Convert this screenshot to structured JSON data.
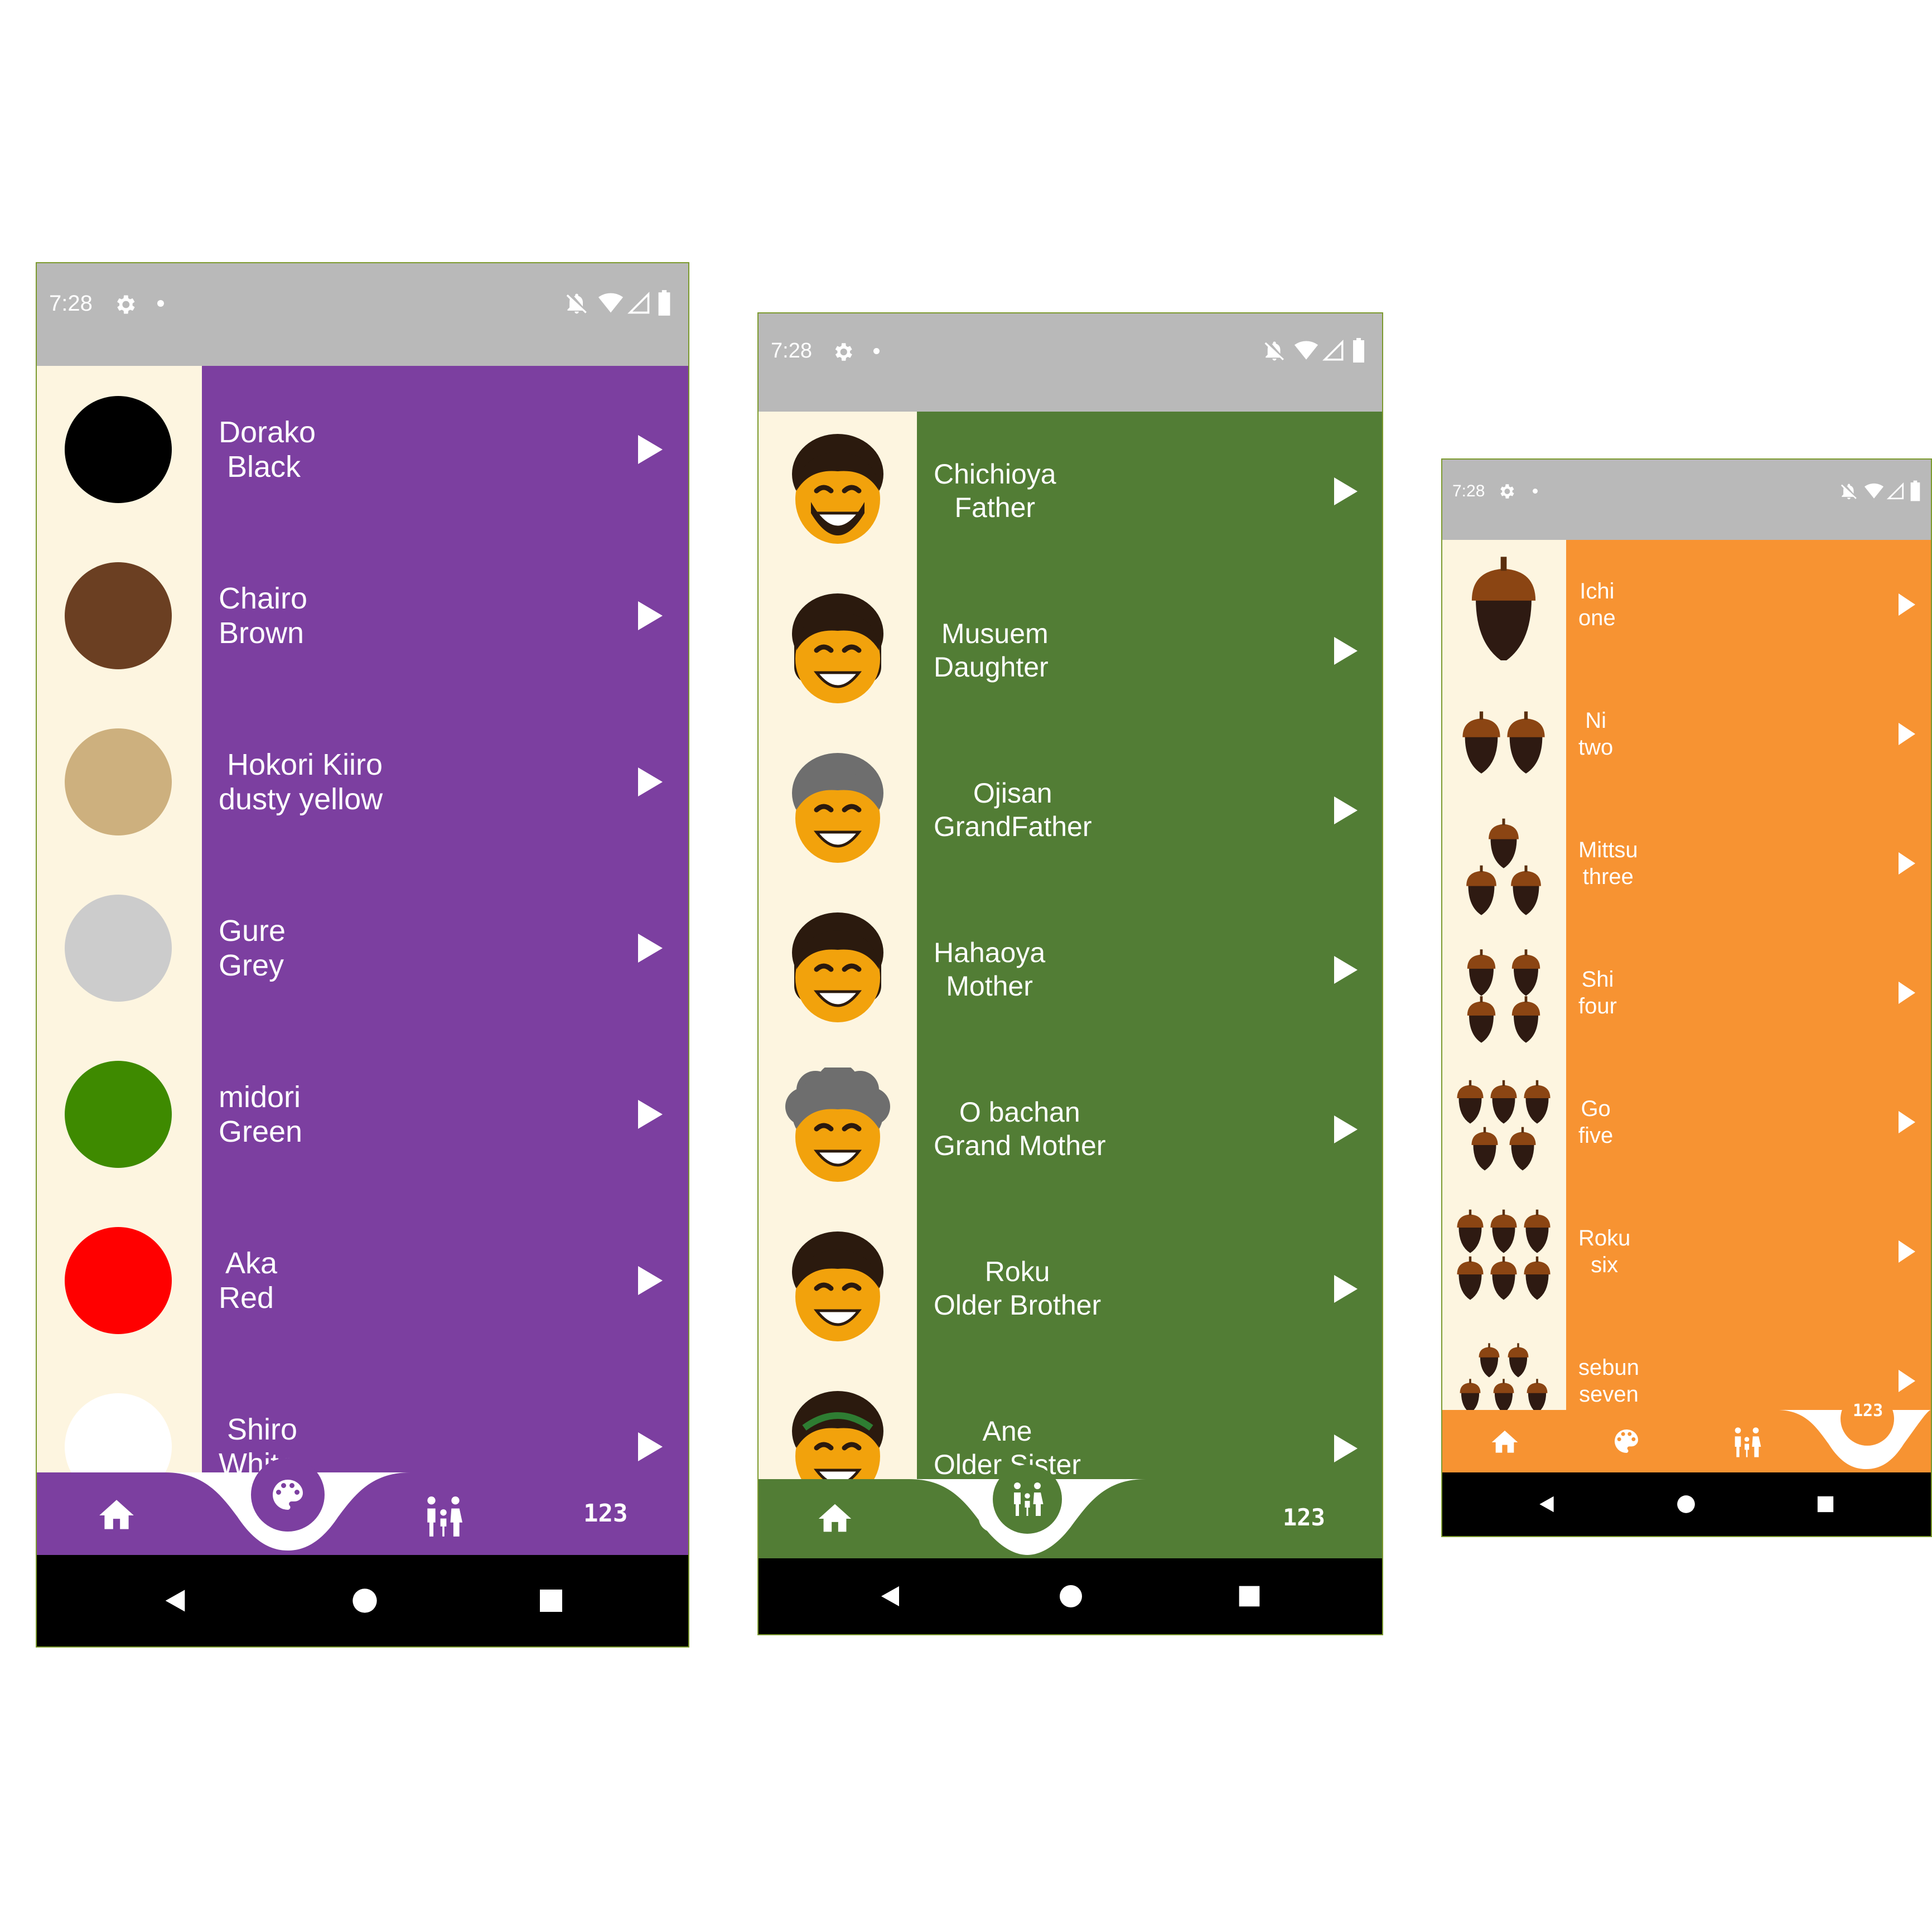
{
  "status_time": "7:28",
  "colors": {
    "purple": "#7c3fa0",
    "green": "#527d35",
    "orange": "#f79332",
    "cream": "#fdf5e0",
    "status_gray": "#b9b9b9"
  },
  "screen_colors": {
    "items": [
      {
        "line1": "Dorako",
        "line2": " Black",
        "swatch": "#000000"
      },
      {
        "line1": "Chairo",
        "line2": "Brown",
        "swatch": "#6b3f22"
      },
      {
        "line1": " Hokori Kiiro",
        "line2": "dusty yellow",
        "swatch": "#cdb07e"
      },
      {
        "line1": "Gure",
        "line2": "Grey",
        "swatch": "#cccccc"
      },
      {
        "line1": "midori",
        "line2": "Green",
        "swatch": "#3e8a00"
      },
      {
        "line1": " Aka",
        "line2": "Red",
        "swatch": "#ff0000"
      },
      {
        "line1": " Shiro",
        "line2": "White",
        "swatch": "#ffffff"
      }
    ],
    "nav": [
      "home-icon",
      "palette-icon",
      "family-icon",
      "numbers-icon"
    ],
    "nav_numbers": "123",
    "active_tab": "palette"
  },
  "screen_family": {
    "items": [
      {
        "line1": "Chichioya",
        "line2": "Father",
        "face": "father"
      },
      {
        "line1": " Musuem",
        "line2": "Daughter",
        "face": "daughter"
      },
      {
        "line1": "Ojisan",
        "line2": "GrandFather",
        "face": "grandfather"
      },
      {
        "line1": "Hahaoya",
        "line2": "Mother",
        "face": "mother"
      },
      {
        "line1": "O bachan",
        "line2": "Grand Mother",
        "face": "grandmother"
      },
      {
        "line1": "Roku",
        "line2": "Older Brother",
        "face": "brother"
      },
      {
        "line1": "Ane",
        "line2": "Older Sister",
        "face": "sister"
      }
    ],
    "nav_numbers": "123",
    "active_tab": "family"
  },
  "screen_numbers": {
    "items": [
      {
        "line1": "Ichi",
        "line2": "one",
        "count": 1
      },
      {
        "line1": "Ni",
        "line2": "two",
        "count": 2
      },
      {
        "line1": "Mittsu",
        "line2": "three",
        "count": 3
      },
      {
        "line1": "Shi",
        "line2": "four",
        "count": 4
      },
      {
        "line1": "Go",
        "line2": "five",
        "count": 5
      },
      {
        "line1": "Roku",
        "line2": "six",
        "count": 6
      },
      {
        "line1": "sebun",
        "line2": "seven",
        "count": 7
      }
    ],
    "nav_numbers": "123",
    "active_tab": "numbers"
  }
}
